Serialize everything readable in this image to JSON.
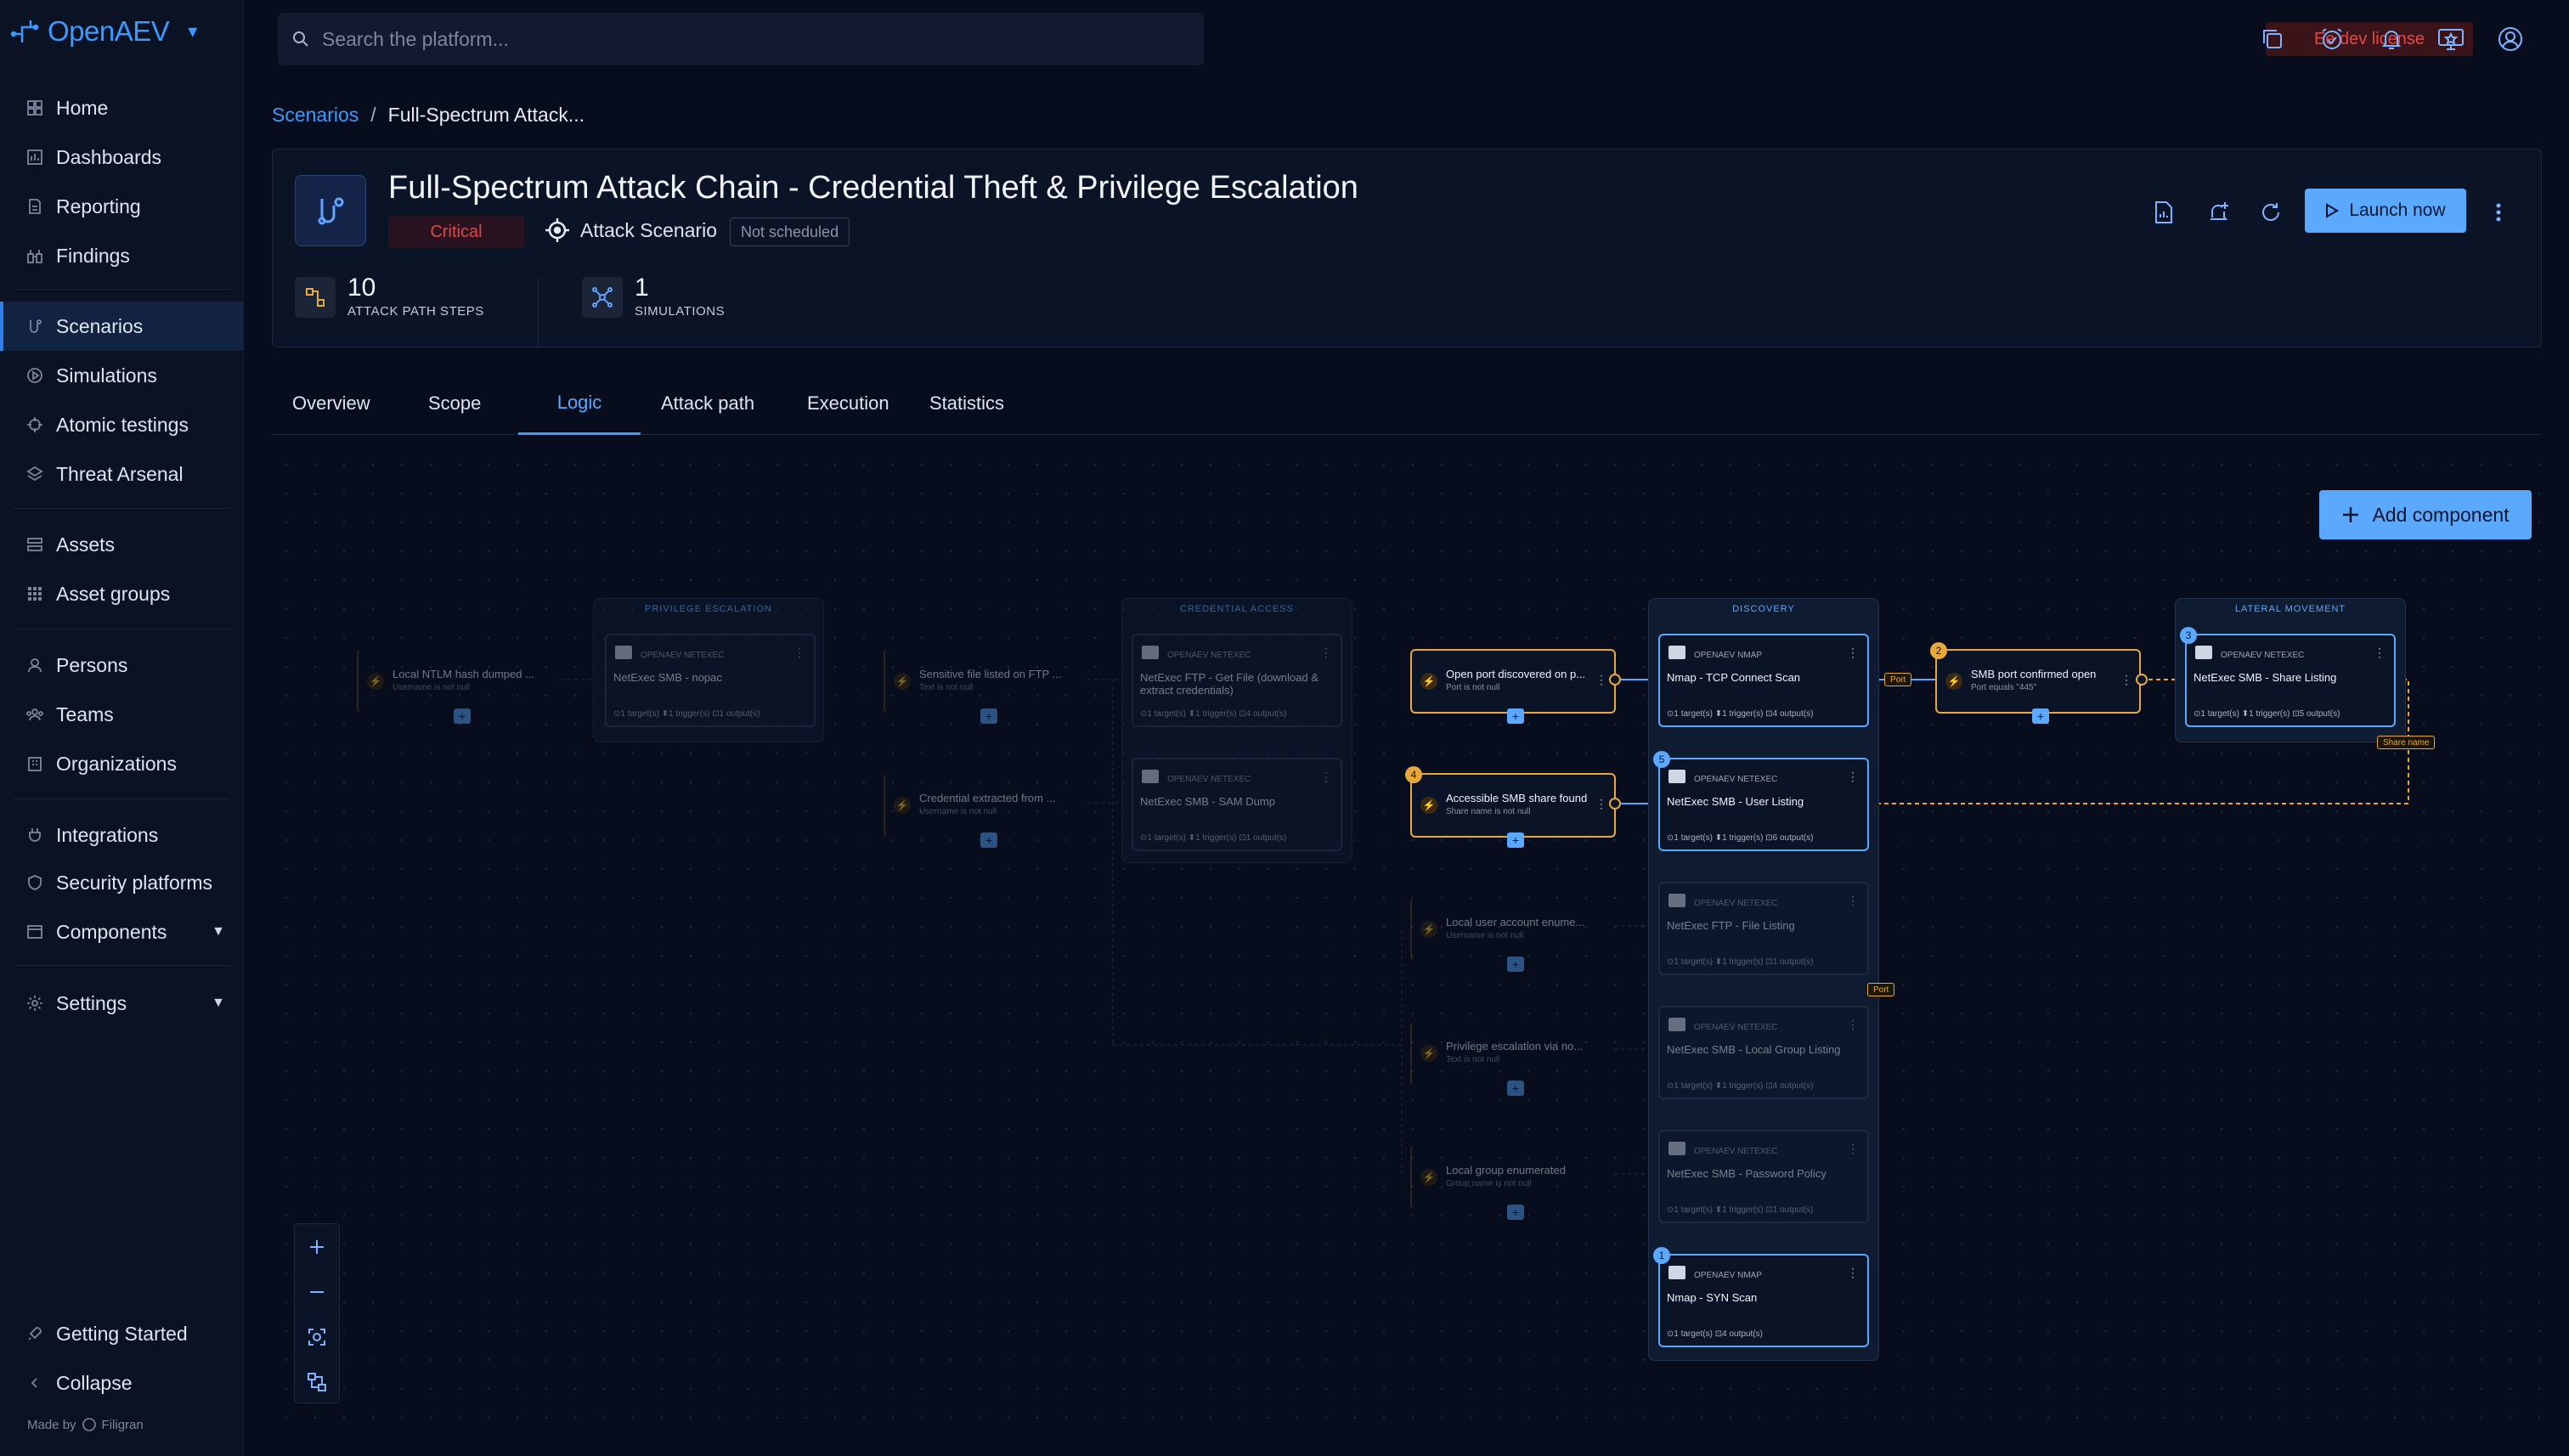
{
  "app": {
    "name": "OpenAEV"
  },
  "search": {
    "placeholder": "Search the platform..."
  },
  "license": "Ee dev license",
  "sidebar": {
    "items": [
      {
        "label": "Home"
      },
      {
        "label": "Dashboards"
      },
      {
        "label": "Reporting"
      },
      {
        "label": "Findings"
      },
      {
        "label": "Scenarios"
      },
      {
        "label": "Simulations"
      },
      {
        "label": "Atomic testings"
      },
      {
        "label": "Threat Arsenal"
      },
      {
        "label": "Assets"
      },
      {
        "label": "Asset groups"
      },
      {
        "label": "Persons"
      },
      {
        "label": "Teams"
      },
      {
        "label": "Organizations"
      },
      {
        "label": "Integrations"
      },
      {
        "label": "Security platforms"
      },
      {
        "label": "Components"
      },
      {
        "label": "Settings"
      }
    ],
    "getting_started": "Getting Started",
    "collapse": "Collapse",
    "made_by": "Made by",
    "made_by_brand": "Filigran"
  },
  "breadcrumb": {
    "root": "Scenarios",
    "current": "Full-Spectrum Attack..."
  },
  "scenario": {
    "title": "Full-Spectrum Attack Chain - Credential Theft & Privilege Escalation",
    "severity": "Critical",
    "type": "Attack Scenario",
    "schedule": "Not scheduled",
    "steps_count": "10",
    "steps_label": "ATTACK PATH STEPS",
    "sims_count": "1",
    "sims_label": "SIMULATIONS",
    "launch_label": "Launch now"
  },
  "tabs": [
    "Overview",
    "Scope",
    "Logic",
    "Attack path",
    "Execution",
    "Statistics"
  ],
  "canvas": {
    "add_component": "Add component",
    "groups": {
      "privilege_escalation": "PRIVILEGE ESCALATION",
      "credential_access": "CREDENTIAL ACCESS",
      "discovery": "DISCOVERY",
      "lateral_movement": "LATERAL MOVEMENT"
    },
    "conditions": {
      "c1_title": "Local NTLM hash dumped ...",
      "c1_sub": "Username is not null",
      "c2_title": "Sensitive file listed on FTP ...",
      "c2_sub": "Text is not null",
      "c3_title": "Credential extracted from ...",
      "c3_sub": "Username is not null",
      "c4_title": "Open port discovered on p...",
      "c4_sub": "Port is not null",
      "c5_title": "Accessible SMB share found",
      "c5_sub": "Share name is not null",
      "c5_num": "4",
      "c6_title": "Local user account enume...",
      "c6_sub": "Username is not null",
      "c7_title": "Privilege escalation via no...",
      "c7_sub": "Text is not null",
      "c8_title": "Local group enumerated",
      "c8_sub": "Group name is not null",
      "c9_title": "SMB port confirmed open",
      "c9_sub": "Port equals \"445\"",
      "c9_num": "2"
    },
    "nodes": {
      "n1_prov": "OPENAEV NETEXEC",
      "n1_name": "NetExec SMB - nopac",
      "n1_meta": "⊙1 target(s)  ⬍1 trigger(s)  ⊡1 output(s)",
      "n2_prov": "OPENAEV NETEXEC",
      "n2_name": "NetExec FTP - Get File (download & extract credentials)",
      "n2_meta": "⊙1 target(s)  ⬍1 trigger(s)  ⊡4 output(s)",
      "n3_prov": "OPENAEV NETEXEC",
      "n3_name": "NetExec SMB - SAM Dump",
      "n3_meta": "⊙1 target(s)  ⬍1 trigger(s)  ⊡1 output(s)",
      "n4_prov": "OPENAEV NMAP",
      "n4_name": "Nmap - TCP Connect Scan",
      "n4_meta": "⊙1 target(s)  ⬍1 trigger(s)  ⊡4 output(s)",
      "n5_prov": "OPENAEV NETEXEC",
      "n5_name": "NetExec SMB - User Listing",
      "n5_meta": "⊙1 target(s)  ⬍1 trigger(s)  ⊡6 output(s)",
      "n5_num": "5",
      "n6_prov": "OPENAEV NETEXEC",
      "n6_name": "NetExec FTP - File Listing",
      "n6_meta": "⊙1 target(s)  ⬍1 trigger(s)  ⊡1 output(s)",
      "n7_prov": "OPENAEV NETEXEC",
      "n7_name": "NetExec SMB - Local Group Listing",
      "n7_meta": "⊙1 target(s)  ⬍1 trigger(s)  ⊡4 output(s)",
      "n8_prov": "OPENAEV NETEXEC",
      "n8_name": "NetExec SMB - Password Policy",
      "n8_meta": "⊙1 target(s)  ⬍1 trigger(s)  ⊡1 output(s)",
      "n9_prov": "OPENAEV NMAP",
      "n9_name": "Nmap - SYN Scan",
      "n9_meta": "⊙1 target(s)  ⊡4 output(s)",
      "n9_num": "1",
      "n10_prov": "OPENAEV NETEXEC",
      "n10_name": "NetExec SMB - Share Listing",
      "n10_meta": "⊙1 target(s)  ⬍1 trigger(s)  ⊡5 output(s)",
      "n10_num": "3"
    },
    "edge_tags": {
      "port1": "Port",
      "port2": "Port",
      "share": "Share name"
    }
  },
  "colors": {
    "accent": "#3b9aff",
    "critical": "#e04848",
    "condition": "#e8a93b",
    "background": "#070d1c"
  }
}
